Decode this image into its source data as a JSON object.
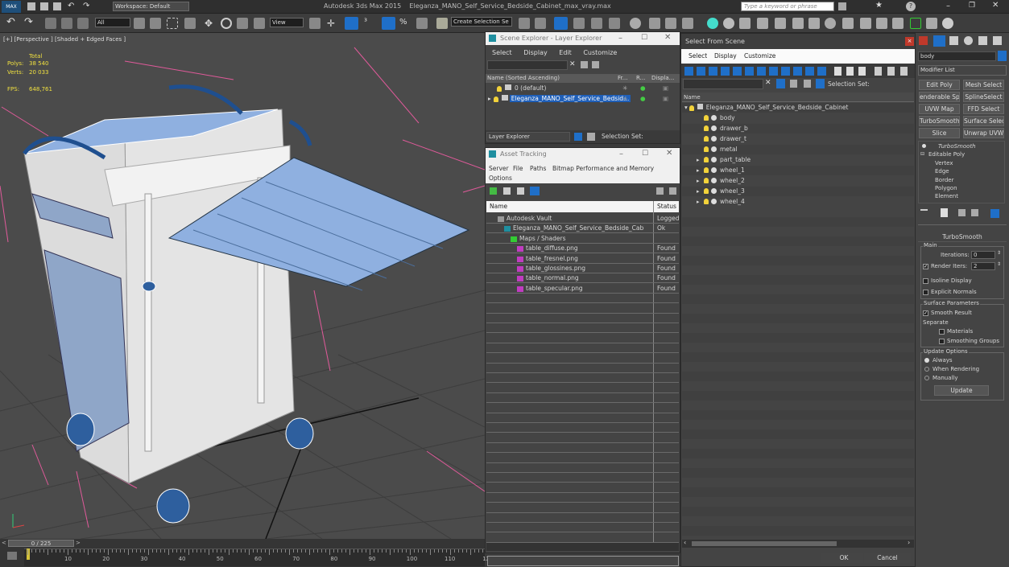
{
  "app": {
    "title": "Autodesk 3ds Max  2015",
    "file": "Eleganza_MANO_Self_Service_Bedside_Cabinet_max_vray.max",
    "workspace": "Workspace: Default",
    "search_placeholder": "Type a keyword or phrase"
  },
  "toolbar": {
    "filter": "All",
    "view": "View",
    "selection_set": "Create Selection Se"
  },
  "viewport": {
    "label": "[+] [Perspective ] [Shaded + Edged Faces ]",
    "stats_header": "Total",
    "polys_label": "Polys:",
    "polys": "38 540",
    "verts_label": "Verts:",
    "verts": "20 033",
    "fps_label": "FPS:",
    "fps": "648,761"
  },
  "timeline": {
    "frame": "0 / 225",
    "ticks": [
      "10",
      "20",
      "30",
      "40",
      "50",
      "60",
      "70",
      "80",
      "90",
      "100",
      "110",
      "12"
    ]
  },
  "scene_explorer": {
    "title": "Scene Explorer - Layer Explorer",
    "menus": [
      "Select",
      "Display",
      "Edit",
      "Customize"
    ],
    "columns": [
      "Name (Sorted Ascending)",
      "Fr...",
      "R...",
      "Displa..."
    ],
    "rows": [
      "0 (default)",
      "Eleganza_MANO_Self_Service_Bedsid..."
    ],
    "footer_left": "Layer Explorer",
    "footer_right": "Selection Set:"
  },
  "asset_tracking": {
    "title": "Asset Tracking",
    "menus": [
      "Server",
      "File",
      "Paths",
      "Bitmap Performance and Memory",
      "Options"
    ],
    "col_name": "Name",
    "col_status": "Status",
    "rows": [
      {
        "name": "Autodesk Vault",
        "status": "Logged",
        "indent": 0
      },
      {
        "name": "Eleganza_MANO_Self_Service_Bedside_Cabinet...",
        "status": "Ok",
        "indent": 1
      },
      {
        "name": "Maps / Shaders",
        "status": "",
        "indent": 2
      },
      {
        "name": "table_diffuse.png",
        "status": "Found",
        "indent": 3
      },
      {
        "name": "table_fresnel.png",
        "status": "Found",
        "indent": 3
      },
      {
        "name": "table_glossines.png",
        "status": "Found",
        "indent": 3
      },
      {
        "name": "table_normal.png",
        "status": "Found",
        "indent": 3
      },
      {
        "name": "table_specular.png",
        "status": "Found",
        "indent": 3
      }
    ]
  },
  "select_from_scene": {
    "title": "Select From Scene",
    "menus": [
      "Select",
      "Display",
      "Customize"
    ],
    "selection_set": "Selection Set:",
    "col_name": "Name",
    "root": "Eleganza_MANO_Self_Service_Bedside_Cabinet",
    "children": [
      {
        "name": "body",
        "expand": false
      },
      {
        "name": "drawer_b",
        "expand": false
      },
      {
        "name": "drawer_t",
        "expand": false
      },
      {
        "name": "metal",
        "expand": false
      },
      {
        "name": "part_table",
        "expand": true
      },
      {
        "name": "wheel_1",
        "expand": true
      },
      {
        "name": "wheel_2",
        "expand": true
      },
      {
        "name": "wheel_3",
        "expand": true
      },
      {
        "name": "wheel_4",
        "expand": true
      }
    ],
    "ok": "OK",
    "cancel": "Cancel"
  },
  "command_panel": {
    "object_name": "body",
    "modifier_list": "Modifier List",
    "buttons": [
      "Edit Poly",
      "Mesh Select",
      "enderable Splin",
      "SplineSelect",
      "UVW Map",
      "FFD Select",
      "TurboSmooth",
      "Surface Select",
      "Slice",
      "Unwrap UVW"
    ],
    "stack": [
      "TurboSmooth",
      "Editable Poly",
      "Vertex",
      "Edge",
      "Border",
      "Polygon",
      "Element"
    ],
    "rollout": "TurboSmooth",
    "main": "Main",
    "iterations_label": "Iterations:",
    "iterations": "0",
    "render_iters_label": "Render Iters:",
    "render_iters": "2",
    "isoline": "Isoline Display",
    "explicit_normals": "Explicit Normals",
    "surface_params": "Surface Parameters",
    "smooth_result": "Smooth Result",
    "separate": "Separate",
    "materials": "Materials",
    "smoothing_groups": "Smoothing Groups",
    "update_options": "Update Options",
    "always": "Always",
    "when_rendering": "When Rendering",
    "manually": "Manually",
    "update": "Update"
  },
  "colors": {
    "accent": "#2f7de0",
    "selection": "#1f5fb8",
    "mesh": "#8fb0e0"
  }
}
